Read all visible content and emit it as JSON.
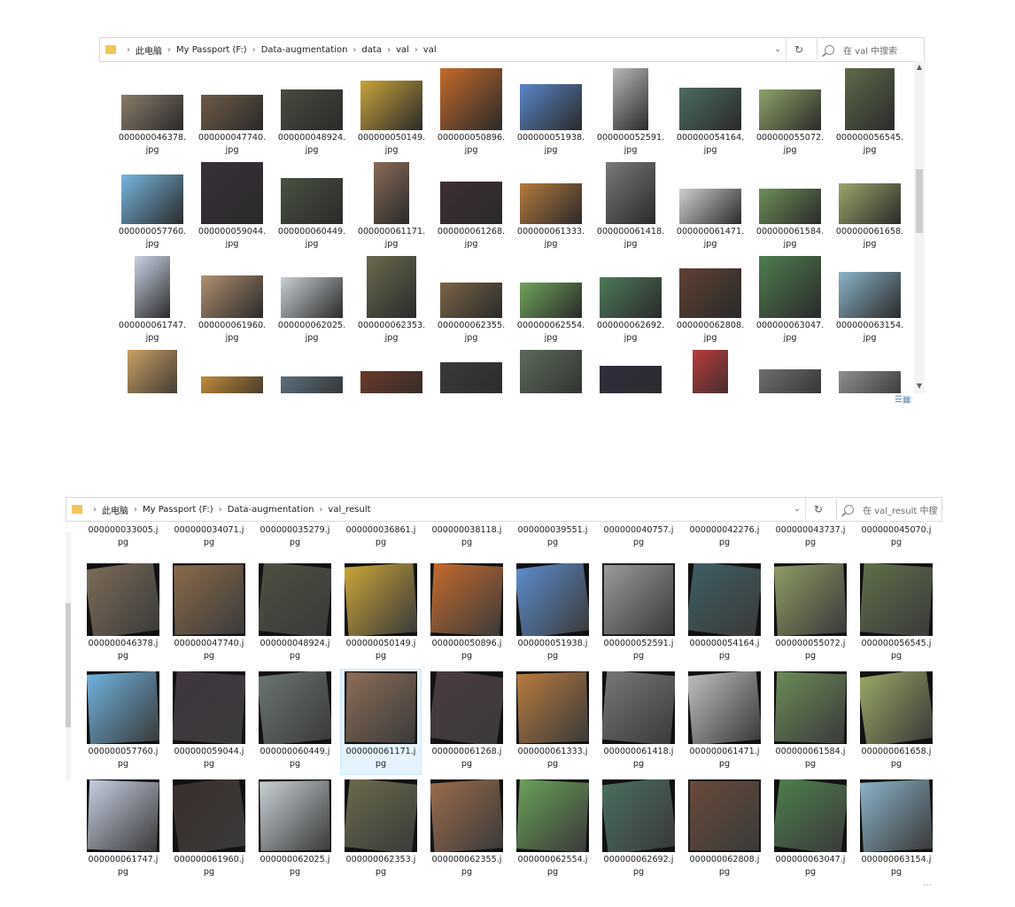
{
  "window_top": {
    "breadcrumb": [
      "此电脑",
      "My Passport (F:)",
      "Data-augmentation",
      "data",
      "val",
      "val"
    ],
    "search_placeholder": "在 val 中搜索",
    "rows": [
      [
        "000000046378.",
        "000000047740.",
        "000000048924.",
        "000000050149.",
        "000000050896.",
        "000000051938.",
        "000000052591.",
        "000000054164.",
        "000000055072.",
        "000000056545."
      ],
      [
        "000000057760.",
        "000000059044.",
        "000000060449.",
        "000000061171.",
        "000000061268.",
        "000000061333.",
        "000000061418.",
        "000000061471.",
        "000000061584.",
        "000000061658."
      ],
      [
        "000000061747.",
        "000000061960.",
        "000000062025.",
        "000000062353.",
        "000000062355.",
        "000000062554.",
        "000000062692.",
        "000000062808.",
        "000000063047.",
        "000000063154."
      ]
    ],
    "ext": "jpg",
    "thumb_colors": [
      [
        "#8b7c6a",
        "#6e5b47",
        "#4b4a3f",
        "#c9a43a",
        "#c56a2a",
        "#5a86c8",
        "#b8b8b8",
        "#4d6b63",
        "#8fa36a",
        "#5e6b4a"
      ],
      [
        "#77b6e0",
        "#3a2f3a",
        "#4a5242",
        "#8a6b57",
        "#3e2e32",
        "#b67a3d",
        "#7a7a7a",
        "#cfcfcf",
        "#6e8f5a",
        "#9aa66a"
      ],
      [
        "#c9d3e6",
        "#b09070",
        "#c7cfd3",
        "#6b6a4e",
        "#7a6446",
        "#6fa35a",
        "#4e7a5a",
        "#5e4032",
        "#4f7d4f",
        "#8bb3c8"
      ],
      [
        "#c7a065",
        "#c18a3a",
        "#5d6f7c",
        "#6a3a2a",
        "#3a3a3a",
        "#5b6a5a",
        "#2f2f3f",
        "#b83c3c",
        "#6f6f6f",
        "#909090"
      ]
    ]
  },
  "window_bottom": {
    "breadcrumb": [
      "此电脑",
      "My Passport (F:)",
      "Data-augmentation",
      "val_result"
    ],
    "search_placeholder": "在 val_result 中搜",
    "top_partial_row": [
      "000000033005.j",
      "000000034071.j",
      "000000035279.j",
      "000000036861.j",
      "000000038118.j",
      "000000039551.j",
      "000000040757.j",
      "000000042276.j",
      "000000043737.j",
      "000000045070.j"
    ],
    "rows": [
      [
        "000000046378.j",
        "000000047740.j",
        "000000048924.j",
        "000000050149.j",
        "000000050896.j",
        "000000051938.j",
        "000000052591.j",
        "000000054164.j",
        "000000055072.j",
        "000000056545.j"
      ],
      [
        "000000057760.j",
        "000000059044.j",
        "000000060449.j",
        "000000061171.j",
        "000000061268.j",
        "000000061333.j",
        "000000061418.j",
        "000000061471.j",
        "000000061584.j",
        "000000061658.j"
      ],
      [
        "000000061747.j",
        "000000061960.j",
        "000000062025.j",
        "000000062353.j",
        "000000062355.j",
        "000000062554.j",
        "000000062692.j",
        "000000062808.j",
        "000000063047.j",
        "000000063154.j"
      ]
    ],
    "ext": "pg",
    "selected_item": "000000061171.j",
    "thumb_colors": [
      [
        "#7d6c58",
        "#8a6a4a",
        "#4c5040",
        "#c9a438",
        "#c56a2c",
        "#5c8ccc",
        "#9a9a9a",
        "#3e5e63",
        "#8e9b64",
        "#5f6f4a"
      ],
      [
        "#6fb2de",
        "#403540",
        "#6a7470",
        "#8c6d57",
        "#4a3a3e",
        "#b97b3e",
        "#777777",
        "#bdbdbd",
        "#6b8b58",
        "#98a765"
      ],
      [
        "#c4cde0",
        "#3a2e2a",
        "#c7cfd3",
        "#6a6a4c",
        "#9a6a4a",
        "#6aa058",
        "#4a6e5e",
        "#6a4a3a",
        "#4e7e4c",
        "#8ab1c6"
      ]
    ]
  }
}
